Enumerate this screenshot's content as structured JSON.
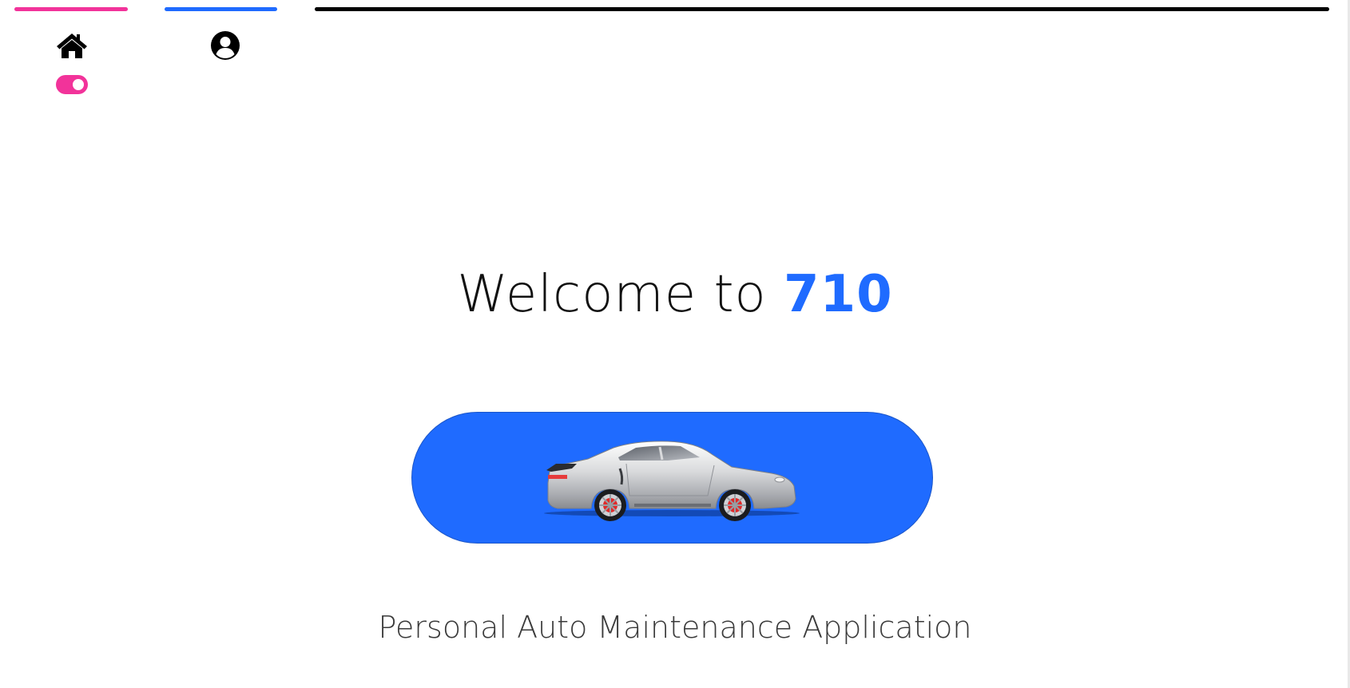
{
  "nav": {
    "home_icon": "home-icon",
    "profile_icon": "user-circle-icon",
    "theme_toggle_on": true
  },
  "colors": {
    "pink": "#f2339a",
    "blue": "#1f6bff",
    "black": "#000000",
    "text": "#111111",
    "subtitle": "#3a3a3a"
  },
  "hero": {
    "welcome_text": "Welcome to ",
    "brand_text": "710",
    "subtitle": "Personal Auto Maintenance Application",
    "button_image": "sports-car-image"
  }
}
